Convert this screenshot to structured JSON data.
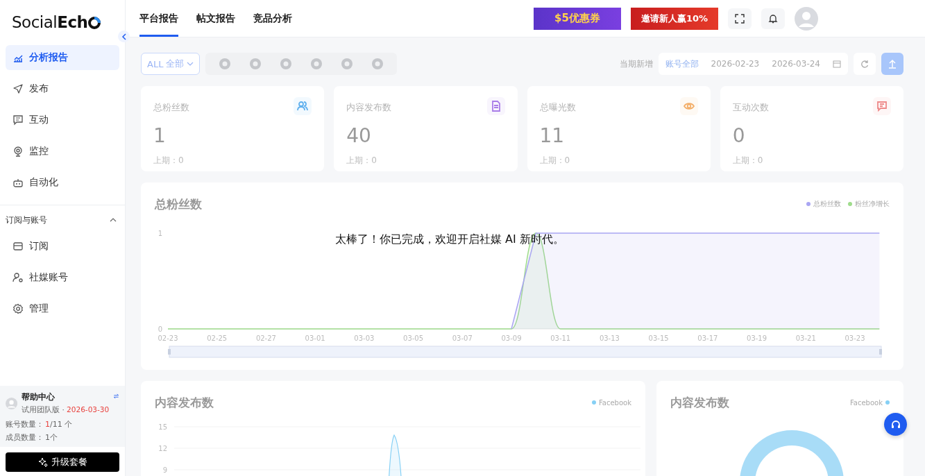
{
  "logo": {
    "light": "Social",
    "bold": "Ech"
  },
  "sidebar": {
    "items": [
      {
        "label": "分析报告",
        "selected": true
      },
      {
        "label": "发布",
        "selected": false
      },
      {
        "label": "互动",
        "selected": false
      },
      {
        "label": "监控",
        "selected": false
      },
      {
        "label": "自动化",
        "selected": false
      }
    ],
    "section": {
      "title": "订阅与账号",
      "expanded": true,
      "items": [
        {
          "label": "订阅",
          "selected": false
        },
        {
          "label": "社媒账号",
          "selected": false
        },
        {
          "label": "管理",
          "selected": false
        }
      ]
    },
    "help": {
      "title": "帮助中心",
      "plan": "试用团队版 ·",
      "expiry": "2026-03-30",
      "accounts_label": "账号数量：",
      "accounts_used": "1",
      "accounts_total": "/11 个",
      "members_label": "成员数量：",
      "members": "1个"
    },
    "upgrade_button": "升级套餐"
  },
  "tabs": [
    {
      "label": "平台报告",
      "selected": true
    },
    {
      "label": "帖文报告",
      "selected": false
    },
    {
      "label": "竞品分析",
      "selected": false
    }
  ],
  "promos": [
    "$5优惠券",
    "邀请新人赢10%"
  ],
  "toolbar": {
    "filter_prefix": "ALL",
    "filter_value": "全部",
    "period_label": "当期新增",
    "account_select": "账号全部",
    "date_start": "2026-02-23",
    "date_end": "2026-03-24"
  },
  "stats": [
    {
      "title": "总粉丝数",
      "value": "1",
      "previous": "上期：0",
      "color": "#5fb0ee"
    },
    {
      "title": "内容发布数",
      "value": "40",
      "previous": "上期：0",
      "color": "#a97de8"
    },
    {
      "title": "总曝光数",
      "value": "11",
      "previous": "上期：0",
      "color": "#f3ae68"
    },
    {
      "title": "互动次数",
      "value": "0",
      "previous": "上期：0",
      "color": "#ee8a8a"
    }
  ],
  "fans_chart": {
    "title": "总粉丝数",
    "chart_data": {
      "type": "line",
      "categories": [
        "02-23",
        null,
        "02-25",
        null,
        "02-27",
        null,
        "03-01",
        null,
        "03-03",
        null,
        "03-05",
        null,
        "03-07",
        null,
        "03-09",
        null,
        "03-11",
        null,
        "03-13",
        null,
        "03-15",
        null,
        "03-17",
        null,
        "03-19",
        null,
        "03-21",
        null,
        "03-23",
        null
      ],
      "ylim": [
        0,
        1
      ],
      "yticks": [
        0,
        1
      ],
      "series": [
        {
          "name": "总粉丝数",
          "color": "#a9a5f2",
          "values": [
            null,
            null,
            null,
            null,
            null,
            null,
            null,
            null,
            null,
            null,
            null,
            null,
            null,
            null,
            0,
            1,
            1,
            1,
            1,
            1,
            1,
            1,
            1,
            1,
            1,
            1,
            1,
            1,
            1,
            1
          ]
        },
        {
          "name": "粉丝净增长",
          "color": "#9fdc8c",
          "values": [
            0,
            0,
            0,
            0,
            0,
            0,
            0,
            0,
            0,
            0,
            0,
            0,
            0,
            0,
            0,
            1,
            0,
            0,
            0,
            0,
            0,
            0,
            0,
            0,
            0,
            0,
            0,
            0,
            0,
            0
          ]
        }
      ]
    }
  },
  "posts_chart": {
    "title": "内容发布数",
    "legend": "Facebook",
    "y_tick_labels": [
      "15",
      "12",
      "9"
    ]
  },
  "share_chart": {
    "title": "内容发布数",
    "legend": "Facebook"
  },
  "message": "太棒了！你已完成，欢迎开启社媒 AI 新时代。"
}
